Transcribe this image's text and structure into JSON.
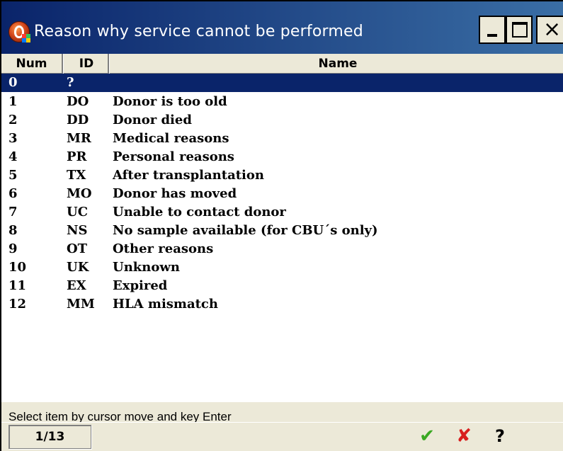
{
  "window": {
    "title": "Reason why service cannot be performed",
    "buttons": {
      "minimize": "minimize",
      "maximize": "maximize",
      "close": "×"
    }
  },
  "columns": {
    "num": "Num",
    "id": "ID",
    "name": "Name"
  },
  "rows": [
    {
      "num": "0",
      "id": "?",
      "name": ""
    },
    {
      "num": "1",
      "id": "DO",
      "name": "Donor is too old"
    },
    {
      "num": "2",
      "id": "DD",
      "name": "Donor died"
    },
    {
      "num": "3",
      "id": "MR",
      "name": "Medical reasons"
    },
    {
      "num": "4",
      "id": "PR",
      "name": "Personal reasons"
    },
    {
      "num": "5",
      "id": "TX",
      "name": "After transplantation"
    },
    {
      "num": "6",
      "id": "MO",
      "name": "Donor has moved"
    },
    {
      "num": "7",
      "id": "UC",
      "name": "Unable to contact donor"
    },
    {
      "num": "8",
      "id": "NS",
      "name": "No sample available (for CBU´s only)"
    },
    {
      "num": "9",
      "id": "OT",
      "name": "Other reasons"
    },
    {
      "num": "10",
      "id": "UK",
      "name": "Unknown"
    },
    {
      "num": "11",
      "id": "EX",
      "name": "Expired"
    },
    {
      "num": "12",
      "id": "MM",
      "name": "HLA mismatch"
    }
  ],
  "selected_index": 0,
  "status": {
    "hint": "Select item by cursor move and key Enter"
  },
  "footer": {
    "page_indicator": "1/13",
    "ok_symbol": "✔",
    "cancel_symbol": "✘",
    "help_symbol": "?"
  },
  "colors": {
    "selection": "#0a246a",
    "ok": "#3aa822",
    "cancel": "#d81e1e",
    "panel": "#ece9d8"
  }
}
